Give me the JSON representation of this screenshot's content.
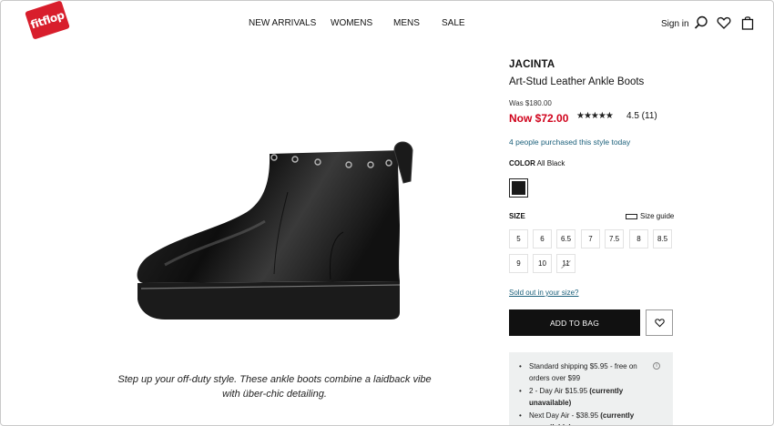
{
  "header": {
    "logo_text": "fitflop",
    "nav": [
      "NEW ARRIVALS",
      "WOMENS",
      "MENS",
      "SALE"
    ],
    "sign_in": "Sign in",
    "icons": [
      "search-icon",
      "heart-icon",
      "bag-icon"
    ]
  },
  "product": {
    "brand": "JACINTA",
    "name": "Art-Stud Leather Ankle Boots",
    "was_price": "Was $180.00",
    "now_price": "Now $72.00",
    "stars_display": "★★★★★",
    "rating": "4.5  (11)",
    "rating_value": 4.5,
    "purchased_note": "4 people purchased this style today",
    "color_label": "COLOR",
    "color_value": "All Black",
    "swatch_color": "#1a1a1a",
    "size_label": "SIZE",
    "size_guide": "Size guide",
    "sizes": [
      "5",
      "6",
      "6.5",
      "7",
      "7.5",
      "8",
      "8.5",
      "9",
      "10",
      "11"
    ],
    "sizes_out_of_stock": [
      "11"
    ],
    "sold_out_link": "Sold out in your size?",
    "add_to_bag": "ADD TO BAG",
    "description": "Step up your off-duty style. These ankle boots combine a laidback vibe with über-chic detailing."
  },
  "shipping": {
    "line1": "Standard shipping $5.95 - free on orders over $99",
    "line2_prefix": "2 - Day Air $15.95 ",
    "line2_strong": "(currently unavailable)",
    "line3_prefix": "Next Day Air -  $38.95 ",
    "line3_strong": "(currently unavailable)",
    "info_icon": "i"
  },
  "colors": {
    "accent_red": "#d0021b",
    "link_teal": "#1a5f7a",
    "button_black": "#111111"
  }
}
